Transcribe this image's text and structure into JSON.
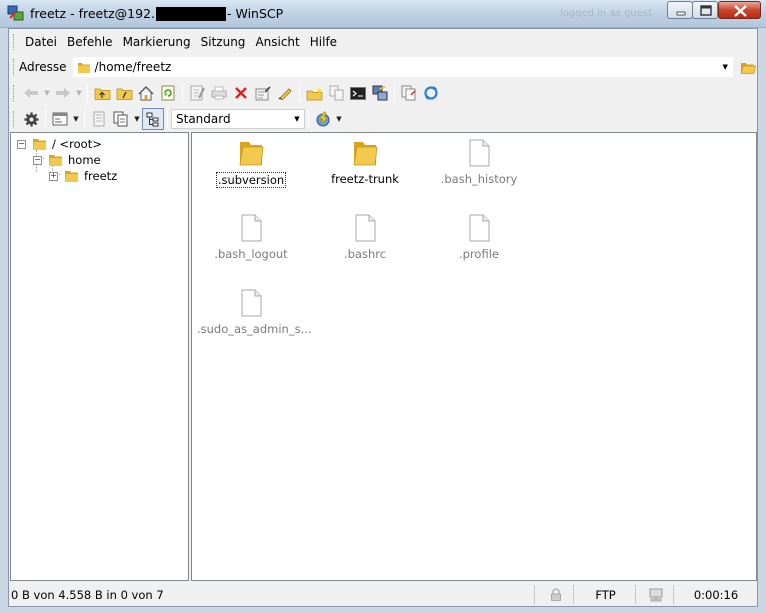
{
  "window": {
    "title_prefix": "freetz - freetz@192.",
    "title_suffix": " - WinSCP",
    "ghost_text": "logged in as guest"
  },
  "menu": {
    "items": [
      "Datei",
      "Befehle",
      "Markierung",
      "Sitzung",
      "Ansicht",
      "Hilfe"
    ]
  },
  "address": {
    "label": "Adresse",
    "value": "/home/freetz"
  },
  "toolbar": {
    "filter_combo_value": "Standard"
  },
  "tree": {
    "nodes": [
      {
        "label": "/ <root>",
        "expander": "−"
      },
      {
        "label": "home",
        "expander": "−"
      },
      {
        "label": "freetz",
        "expander": "+"
      }
    ]
  },
  "files": {
    "items": [
      {
        "name": ".subversion",
        "type": "folder",
        "hidden": false,
        "focused": true
      },
      {
        "name": "freetz-trunk",
        "type": "folder",
        "hidden": false,
        "focused": false
      },
      {
        "name": ".bash_history",
        "type": "file",
        "hidden": true,
        "focused": false
      },
      {
        "name": ".bash_logout",
        "type": "file",
        "hidden": true,
        "focused": false
      },
      {
        "name": ".bashrc",
        "type": "file",
        "hidden": true,
        "focused": false
      },
      {
        "name": ".profile",
        "type": "file",
        "hidden": true,
        "focused": false
      },
      {
        "name": ".sudo_as_admin_s...",
        "type": "file",
        "hidden": true,
        "focused": false
      }
    ]
  },
  "status": {
    "selection": "0 B von 4.558 B in 0 von 7",
    "protocol": "FTP",
    "elapsed": "0:00:16"
  },
  "colors": {
    "folder": "#f2c94c",
    "folder_dark": "#d9a520",
    "close_button": "#c7472e"
  }
}
